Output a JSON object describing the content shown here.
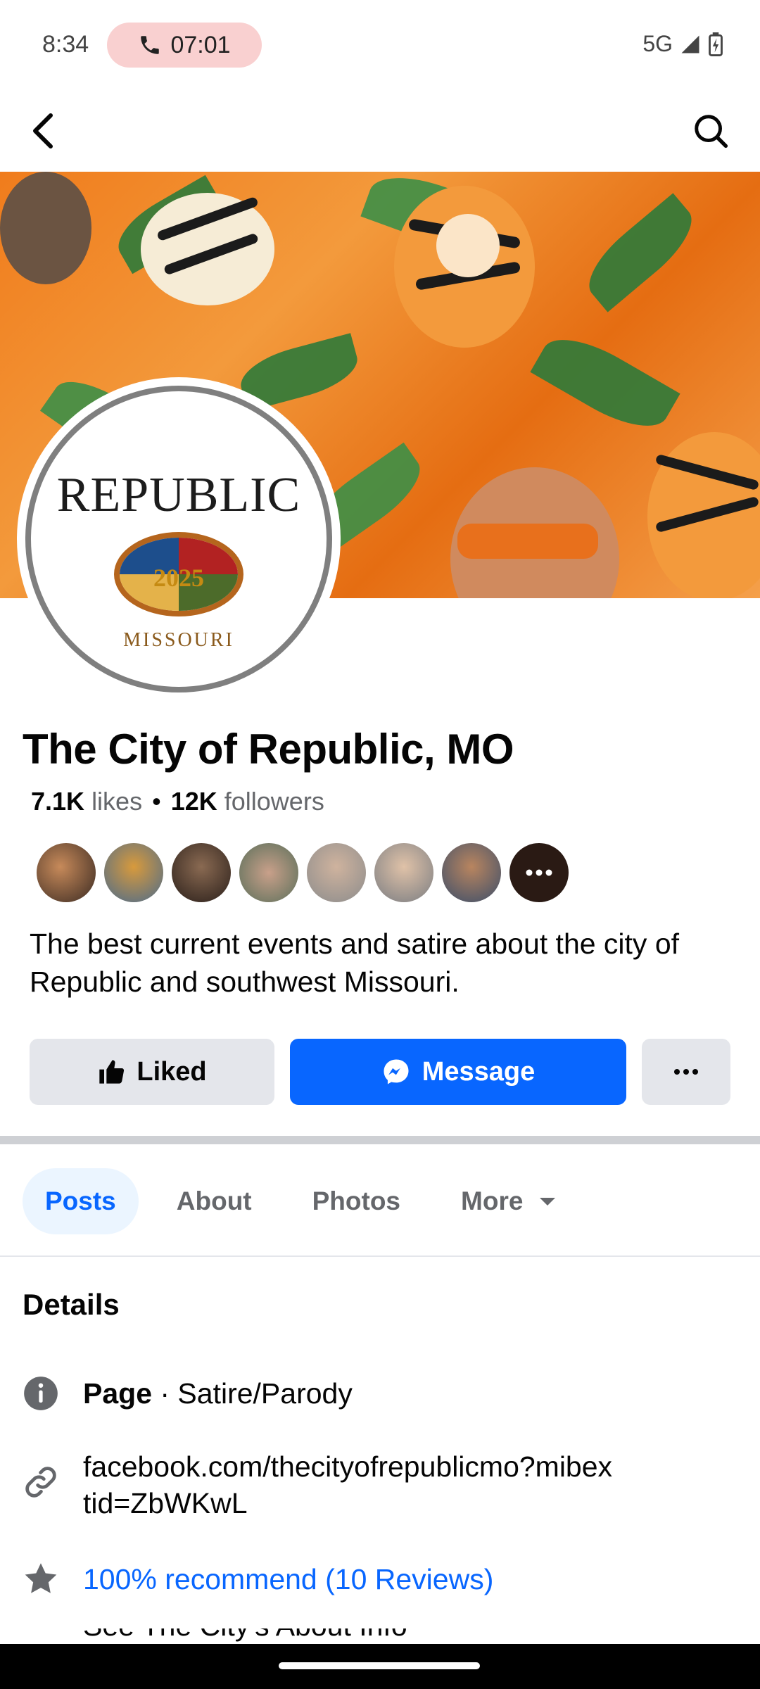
{
  "status_bar": {
    "time": "8:34",
    "call_timer": "07:01",
    "network": "5G"
  },
  "page": {
    "name": "The City of Republic, MO",
    "likes_count": "7.1K",
    "likes_label": "likes",
    "followers_count": "12K",
    "followers_label": "followers",
    "bio": "The best current events and satire about the city of Republic and southwest Missouri."
  },
  "logo": {
    "line1": "REPUBLIC",
    "year": "2025",
    "line2": "MISSOURI"
  },
  "actions": {
    "liked_label": "Liked",
    "message_label": "Message"
  },
  "tabs": [
    {
      "label": "Posts"
    },
    {
      "label": "About"
    },
    {
      "label": "Photos"
    },
    {
      "label": "More"
    }
  ],
  "details": {
    "title": "Details",
    "category_bold": "Page",
    "category_rest": " · Satire/Parody",
    "link": "facebook.com/thecityofrepublicmo?mibextid=ZbWKwL",
    "reviews": "100% recommend (10 Reviews)",
    "see_about": "See The City's About Info"
  },
  "colors": {
    "accent": "#0866ff",
    "button_gray": "#e4e6eb",
    "call_pill": "#f9d0d0"
  }
}
